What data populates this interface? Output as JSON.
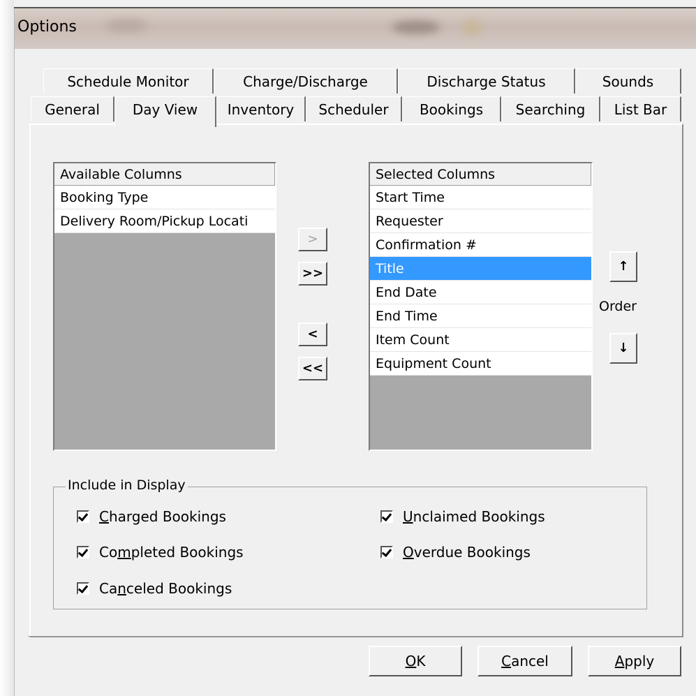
{
  "window": {
    "title": "Options"
  },
  "tabs_back": [
    "Schedule Monitor",
    "Charge/Discharge",
    "Discharge Status",
    "Sounds"
  ],
  "tabs_front": [
    "General",
    "Day View",
    "Inventory",
    "Scheduler",
    "Bookings",
    "Searching",
    "List Bar"
  ],
  "active_tab": "Day View",
  "available": {
    "header": "Available Columns",
    "items": [
      "Booking Type",
      "Delivery Room/Pickup Locati"
    ]
  },
  "selected": {
    "header": "Selected Columns",
    "items": [
      "Start Time",
      "Requester",
      "Confirmation #",
      "Title",
      "End Date",
      "End Time",
      "Item Count",
      "Equipment Count"
    ],
    "selected_item": "Title"
  },
  "move_buttons": {
    "add": ">",
    "add_all": ">>",
    "remove": "<",
    "remove_all": "<<"
  },
  "order": {
    "label": "Order",
    "up": "↑",
    "down": "↓"
  },
  "include": {
    "label": "Include in Display",
    "charged": {
      "pre": "",
      "u": "C",
      "post": "harged Bookings",
      "checked": true
    },
    "completed": {
      "pre": "Co",
      "u": "m",
      "post": "pleted Bookings",
      "checked": true
    },
    "canceled": {
      "pre": "Ca",
      "u": "n",
      "post": "celed Bookings",
      "checked": true
    },
    "unclaimed": {
      "pre": "",
      "u": "U",
      "post": "nclaimed Bookings",
      "checked": true
    },
    "overdue": {
      "pre": "",
      "u": "O",
      "post": "verdue Bookings",
      "checked": true
    }
  },
  "dialog_buttons": {
    "ok": {
      "u": "O",
      "post": "K"
    },
    "cancel": {
      "u": "C",
      "post": "ancel"
    },
    "apply": {
      "u": "A",
      "post": "pply"
    }
  },
  "colors": {
    "selection": "#3399ff",
    "face": "#f0f0f0",
    "list_empty": "#a9a9a9"
  }
}
